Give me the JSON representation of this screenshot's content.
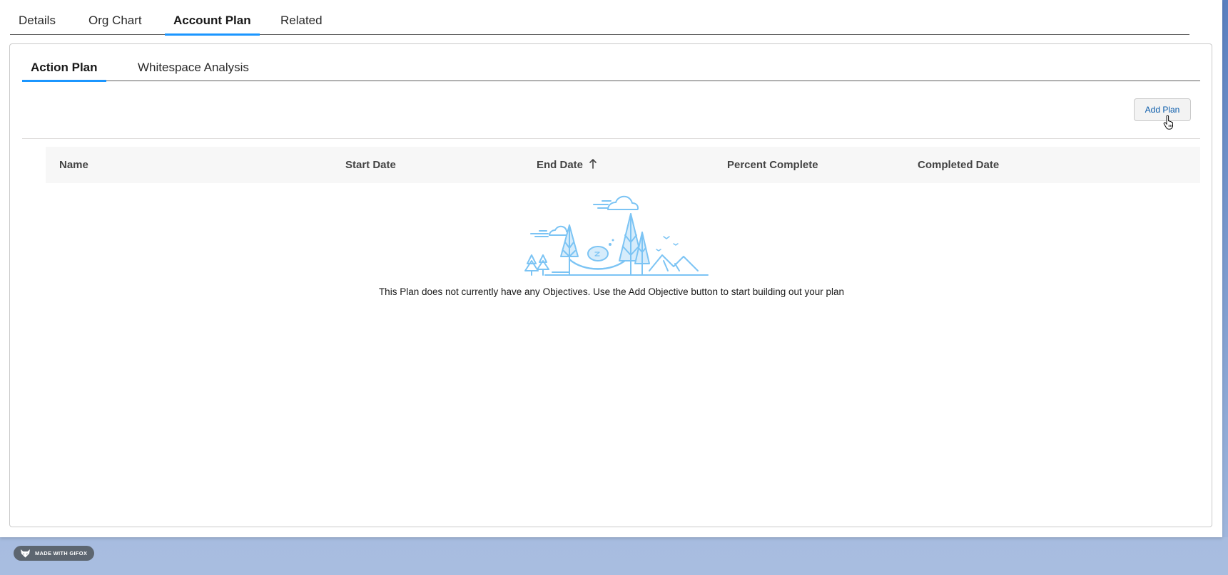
{
  "top_tabs": [
    {
      "label": "Details"
    },
    {
      "label": "Org Chart"
    },
    {
      "label": "Account Plan",
      "active": true
    },
    {
      "label": "Related"
    }
  ],
  "sub_tabs": [
    {
      "label": "Action Plan",
      "active": true
    },
    {
      "label": "Whitespace Analysis"
    }
  ],
  "toolbar": {
    "add_plan_label": "Add Plan"
  },
  "table": {
    "columns": [
      "Name",
      "Start Date",
      "End Date",
      "Percent Complete",
      "Completed Date"
    ],
    "sorted_column": "End Date",
    "sort_direction": "ascending",
    "rows": []
  },
  "empty_state": {
    "message": "This Plan does not currently have any Objectives. Use the Add Objective button to start building out your plan"
  },
  "watermark": {
    "label": "MADE WITH GIFOX"
  },
  "colors": {
    "accent": "#1b96ff",
    "link": "#0b5cab",
    "illustration": "#7cc4f4"
  }
}
